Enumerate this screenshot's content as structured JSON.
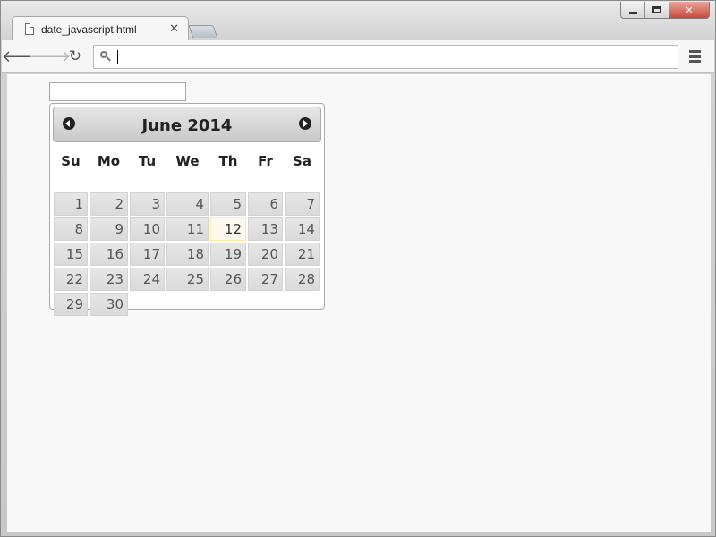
{
  "window": {
    "controls": [
      "minimize",
      "maximize",
      "close"
    ]
  },
  "tabs": [
    {
      "title": "date_javascript.html",
      "active": true
    }
  ],
  "toolbar": {
    "address_value": "",
    "icons": [
      "back-arrow-icon",
      "forward-arrow-icon",
      "reload-icon",
      "search-icon",
      "menu-icon"
    ]
  },
  "page": {
    "date_input_value": ""
  },
  "datepicker": {
    "month_year": "June 2014",
    "prev_label": "Prev",
    "next_label": "Next",
    "weekdays": [
      "Su",
      "Mo",
      "Tu",
      "We",
      "Th",
      "Fr",
      "Sa"
    ],
    "days": [
      "1",
      "2",
      "3",
      "4",
      "5",
      "6",
      "7",
      "8",
      "9",
      "10",
      "11",
      "12",
      "13",
      "14",
      "15",
      "16",
      "17",
      "18",
      "19",
      "20",
      "21",
      "22",
      "23",
      "24",
      "25",
      "26",
      "27",
      "28",
      "29",
      "30"
    ],
    "highlighted_day": "12",
    "colors": {
      "header_gradient_top": "#e6e6e6",
      "header_gradient_bottom": "#c9c9c9",
      "cell_bg": "#e6e6e6",
      "today_bg": "#fbf9ee",
      "today_border": "#fcefa1"
    }
  }
}
